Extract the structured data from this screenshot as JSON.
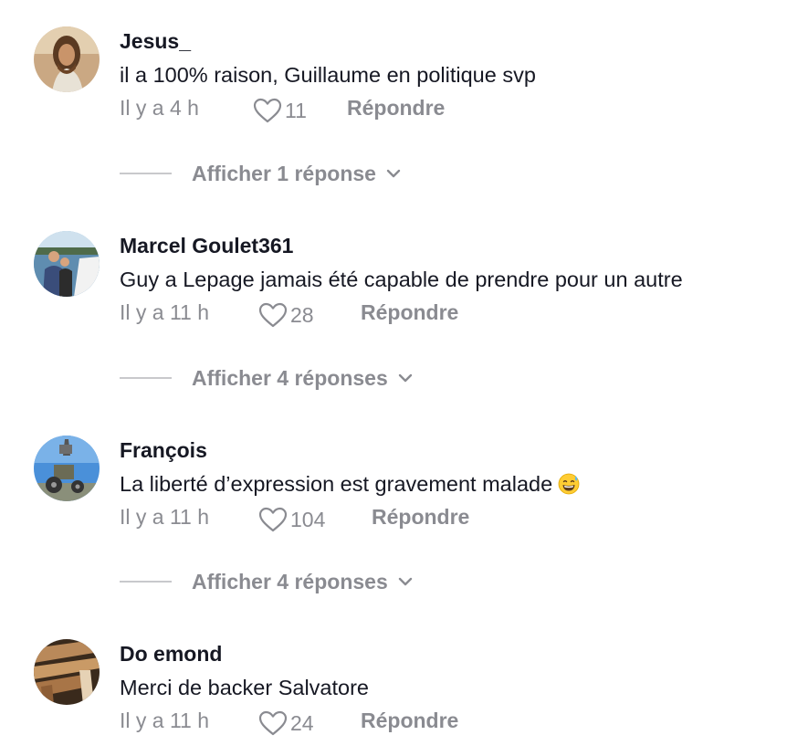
{
  "comments": [
    {
      "username": "Jesus_",
      "text": "il a 100% raison, Guillaume en politique svp",
      "time": "Il y a 4 h",
      "likes": "11",
      "reply_label": "Répondre",
      "replies_label": "Afficher 1 réponse",
      "avatar_icon": "avatar-jesus-painting"
    },
    {
      "username": "Marcel Goulet361",
      "text": "Guy a Lepage jamais été capable de prendre pour un autre",
      "time": "Il y a 11 h",
      "likes": "28",
      "reply_label": "Répondre",
      "replies_label": "Afficher 4 réponses",
      "avatar_icon": "avatar-man-on-boat"
    },
    {
      "username": "François",
      "text": "La liberté d’expression est gravement malade",
      "emoji": "grinning-sweat-emoji",
      "time": "Il y a 11 h",
      "likes": "104",
      "reply_label": "Répondre",
      "replies_label": "Afficher 4 réponses",
      "avatar_icon": "avatar-tractor-sky"
    },
    {
      "username": "Do emond",
      "text": "Merci de backer Salvatore",
      "time": "Il y a 11 h",
      "likes": "24",
      "reply_label": "Répondre",
      "avatar_icon": "avatar-wood-planks"
    }
  ],
  "colors": {
    "text": "#161823",
    "muted": "#8a8b91",
    "divider": "#c8c9cc"
  }
}
